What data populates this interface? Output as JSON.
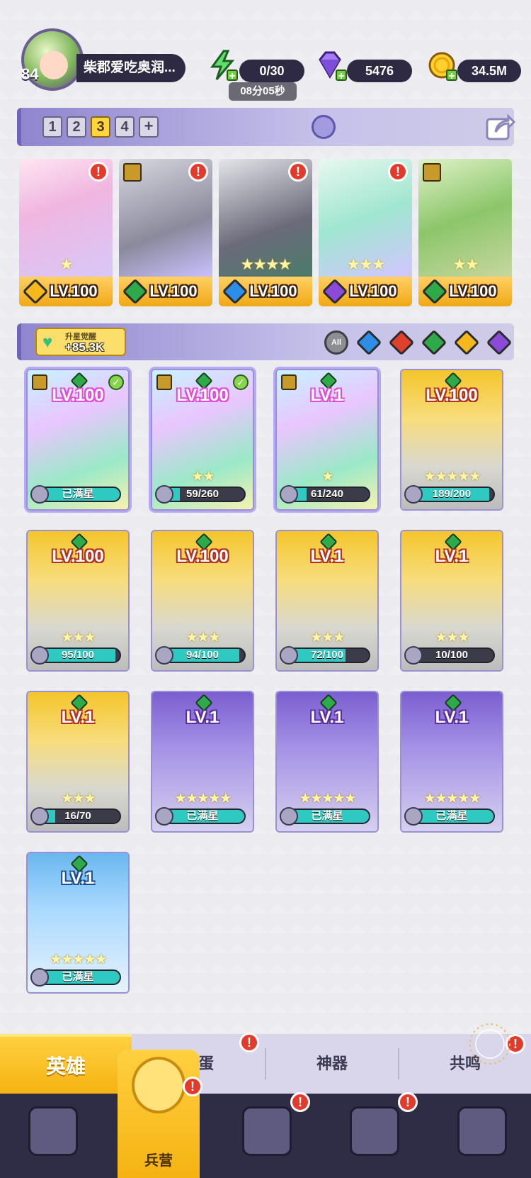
{
  "player": {
    "level": "84",
    "name": "柴郡爱吃奥润..."
  },
  "resources": {
    "energy": "0/30",
    "energy_timer": "08分05秒",
    "gems": "5476",
    "gold": "34.5M"
  },
  "teams": {
    "tabs": [
      "1",
      "2",
      "3",
      "4",
      "+"
    ],
    "active_index": 2
  },
  "team_cards": [
    {
      "level": "LV.100",
      "element": "light",
      "element_color": "#f6b81c",
      "stars": "★",
      "alert": true,
      "tier": false
    },
    {
      "level": "LV.100",
      "element": "nature",
      "element_color": "#2faa4a",
      "stars": "",
      "alert": true,
      "tier": true
    },
    {
      "level": "LV.100",
      "element": "water",
      "element_color": "#2c8ee6",
      "stars": "★★★★",
      "alert": true,
      "tier": false
    },
    {
      "level": "LV.100",
      "element": "dark",
      "element_color": "#8c4ad8",
      "stars": "★★★",
      "alert": true,
      "tier": false
    },
    {
      "level": "LV.100",
      "element": "nature",
      "element_color": "#2faa4a",
      "stars": "★★",
      "alert": false,
      "tier": true
    }
  ],
  "filter": {
    "power_label": "升星觉醒",
    "power_value": "+85.3K",
    "all_label": "All",
    "elements": [
      {
        "name": "water",
        "color": "#2c8ee6"
      },
      {
        "name": "fire",
        "color": "#e0402c"
      },
      {
        "name": "nature",
        "color": "#2faa4a"
      },
      {
        "name": "light",
        "color": "#f6b81c"
      },
      {
        "name": "dark",
        "color": "#8c4ad8"
      }
    ]
  },
  "heroes": [
    {
      "level": "LV.100",
      "progress": "已满星",
      "fill": 1.0,
      "stars": "",
      "check": true,
      "bg": "rainbow"
    },
    {
      "level": "LV.100",
      "progress": "59/260",
      "fill": 0.23,
      "stars": "★★",
      "check": true,
      "bg": "rainbow"
    },
    {
      "level": "LV.1",
      "progress": "61/240",
      "fill": 0.25,
      "stars": "★",
      "check": false,
      "bg": "rainbow"
    },
    {
      "level": "LV.100",
      "progress": "189/200",
      "fill": 0.95,
      "stars": "★★★★★",
      "check": false,
      "bg": "gold"
    },
    {
      "level": "LV.100",
      "progress": "95/100",
      "fill": 0.95,
      "stars": "★★★",
      "check": false,
      "bg": "gold"
    },
    {
      "level": "LV.100",
      "progress": "94/100",
      "fill": 0.94,
      "stars": "★★★",
      "check": false,
      "bg": "gold"
    },
    {
      "level": "LV.1",
      "progress": "72/100",
      "fill": 0.72,
      "stars": "★★★",
      "check": false,
      "bg": "gold"
    },
    {
      "level": "LV.1",
      "progress": "10/100",
      "fill": 0.1,
      "stars": "★★★",
      "check": false,
      "bg": "gold"
    },
    {
      "level": "LV.1",
      "progress": "16/70",
      "fill": 0.23,
      "stars": "★★★",
      "check": false,
      "bg": "gold"
    },
    {
      "level": "LV.1",
      "progress": "已满星",
      "fill": 1.0,
      "stars": "★★★★★",
      "check": false,
      "bg": "purple"
    },
    {
      "level": "LV.1",
      "progress": "已满星",
      "fill": 1.0,
      "stars": "★★★★★",
      "check": false,
      "bg": "purple"
    },
    {
      "level": "LV.1",
      "progress": "已满星",
      "fill": 1.0,
      "stars": "★★★★★",
      "check": false,
      "bg": "purple"
    },
    {
      "level": "LV.1",
      "progress": "已满星",
      "fill": 1.0,
      "stars": "★★★★★",
      "check": false,
      "bg": "blue"
    }
  ],
  "subtabs": {
    "heroes": "英雄",
    "hatch": "孵蛋",
    "artifact": "神器",
    "resonance": "共鸣"
  },
  "bottomnav": {
    "active_label": "兵营"
  }
}
